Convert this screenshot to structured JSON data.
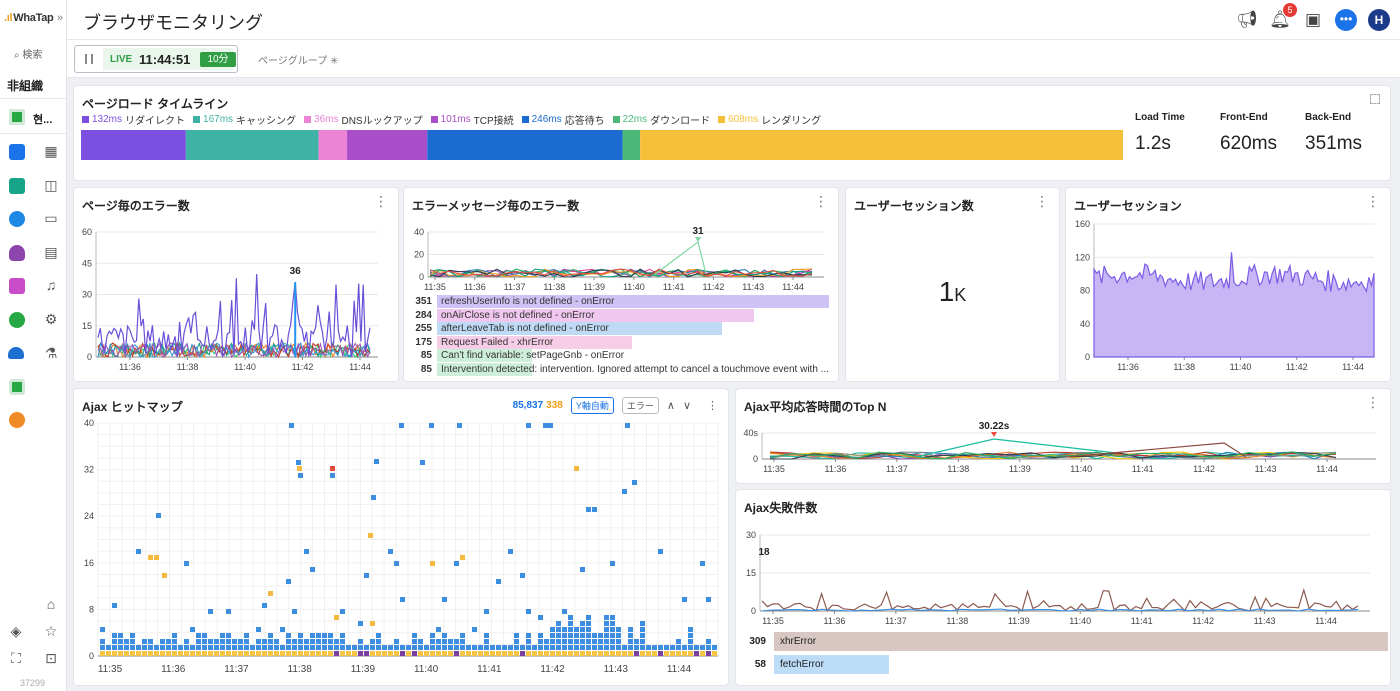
{
  "app": {
    "logo_text": "WhaTap",
    "search_label": "検索",
    "org_label": "非組織",
    "project_label": "현...",
    "footer_number": "37299"
  },
  "header": {
    "title": "ブラウザモニタリング",
    "notification_count": "5",
    "user_initial": "H"
  },
  "toolbar": {
    "live_label": "LIVE",
    "live_time": "11:44:51",
    "time_range": "10分",
    "page_group_label": "ページグループ"
  },
  "timeline": {
    "title": "ページロード タイムライン",
    "segments": [
      {
        "ms": "132ms",
        "label": "リダイレクト",
        "color": "#7b4fe0",
        "value": 132
      },
      {
        "ms": "167ms",
        "label": "キャッシング",
        "color": "#3eb3a5",
        "value": 167
      },
      {
        "ms": "36ms",
        "label": "DNSルックアップ",
        "color": "#ec84d6",
        "value": 36
      },
      {
        "ms": "101ms",
        "label": "TCP接続",
        "color": "#aa4fc9",
        "value": 101
      },
      {
        "ms": "246ms",
        "label": "応答待ち",
        "color": "#1c6bd0",
        "value": 246
      },
      {
        "ms": "22ms",
        "label": "ダウンロード",
        "color": "#4cb878",
        "value": 22
      },
      {
        "ms": "608ms",
        "label": "レンダリング",
        "color": "#f6bf3a",
        "value": 608
      }
    ],
    "stats": [
      {
        "label": "Load Time",
        "value": "1.2s"
      },
      {
        "label": "Front-End",
        "value": "620ms"
      },
      {
        "label": "Back-End",
        "value": "351ms"
      }
    ]
  },
  "page_errors": {
    "title": "ページ毎のエラー数",
    "y_ticks": [
      "60",
      "45",
      "30",
      "15",
      "0"
    ],
    "x_ticks": [
      "11:36",
      "11:38",
      "11:40",
      "11:42",
      "11:44"
    ],
    "peak_label": "36"
  },
  "message_errors": {
    "title": "エラーメッセージ毎のエラー数",
    "y_ticks": [
      "40",
      "20",
      "0"
    ],
    "x_ticks": [
      "11:35",
      "11:36",
      "11:37",
      "11:38",
      "11:39",
      "11:40",
      "11:41",
      "11:42",
      "11:43",
      "11:44"
    ],
    "peak_label": "31",
    "rows": [
      {
        "count": "351",
        "message": "refreshUserInfo is not defined - onError",
        "color": "#cfc3f5",
        "value": 351
      },
      {
        "count": "284",
        "message": "onAirClose is not defined - onError",
        "color": "#f0c7ef",
        "value": 284
      },
      {
        "count": "255",
        "message": "afterLeaveTab is not defined - onError",
        "color": "#bfdaf5",
        "value": 255
      },
      {
        "count": "175",
        "message": "Request Failed - xhrError",
        "color": "#f6cde6",
        "value": 175
      },
      {
        "count": "85",
        "message": "Can't find variable: setPageGnb - onError",
        "color": "#cdeed9",
        "value": 85
      },
      {
        "count": "85",
        "message": "Intervention detected: intervention. Ignored attempt to cancel a touchmove event with ...",
        "color": "#cdeed9",
        "value": 85
      }
    ]
  },
  "user_session_count": {
    "title": "ユーザーセッション数",
    "value": "1",
    "unit": "K"
  },
  "user_session": {
    "title": "ユーザーセッション",
    "y_ticks": [
      "160",
      "120",
      "80",
      "40",
      "0"
    ],
    "x_ticks": [
      "11:36",
      "11:38",
      "11:40",
      "11:42",
      "11:44"
    ]
  },
  "heatmap": {
    "title": "Ajax ヒットマップ",
    "count": "85,837",
    "error_count": "338",
    "y_auto_label": "Y軸自動",
    "error_filter_label": "エラー",
    "y_ticks": [
      "40",
      "32",
      "24",
      "16",
      "8",
      "0"
    ],
    "x_ticks": [
      "11:35",
      "11:36",
      "11:37",
      "11:38",
      "11:39",
      "11:40",
      "11:41",
      "11:42",
      "11:43",
      "11:44"
    ]
  },
  "ajax_topn": {
    "title": "Ajax平均応答時間のTop N",
    "y_ticks": [
      "40s",
      "0"
    ],
    "x_ticks": [
      "11:35",
      "11:36",
      "11:37",
      "11:38",
      "11:39",
      "11:40",
      "11:41",
      "11:42",
      "11:43",
      "11:44"
    ],
    "peak_label": "30.22s"
  },
  "ajax_fail": {
    "title": "Ajax失敗件数",
    "y_ticks": [
      "30",
      "15",
      "0"
    ],
    "x_ticks": [
      "11:35",
      "11:36",
      "11:37",
      "11:38",
      "11:39",
      "11:40",
      "11:41",
      "11:42",
      "11:43",
      "11:44"
    ],
    "peak_label": "18",
    "rows": [
      {
        "count": "309",
        "label": "xhrError",
        "color": "#d8c6c2",
        "value": 309
      },
      {
        "count": "58",
        "label": "fetchError",
        "color": "#bcdcf7",
        "value": 58
      }
    ]
  }
}
